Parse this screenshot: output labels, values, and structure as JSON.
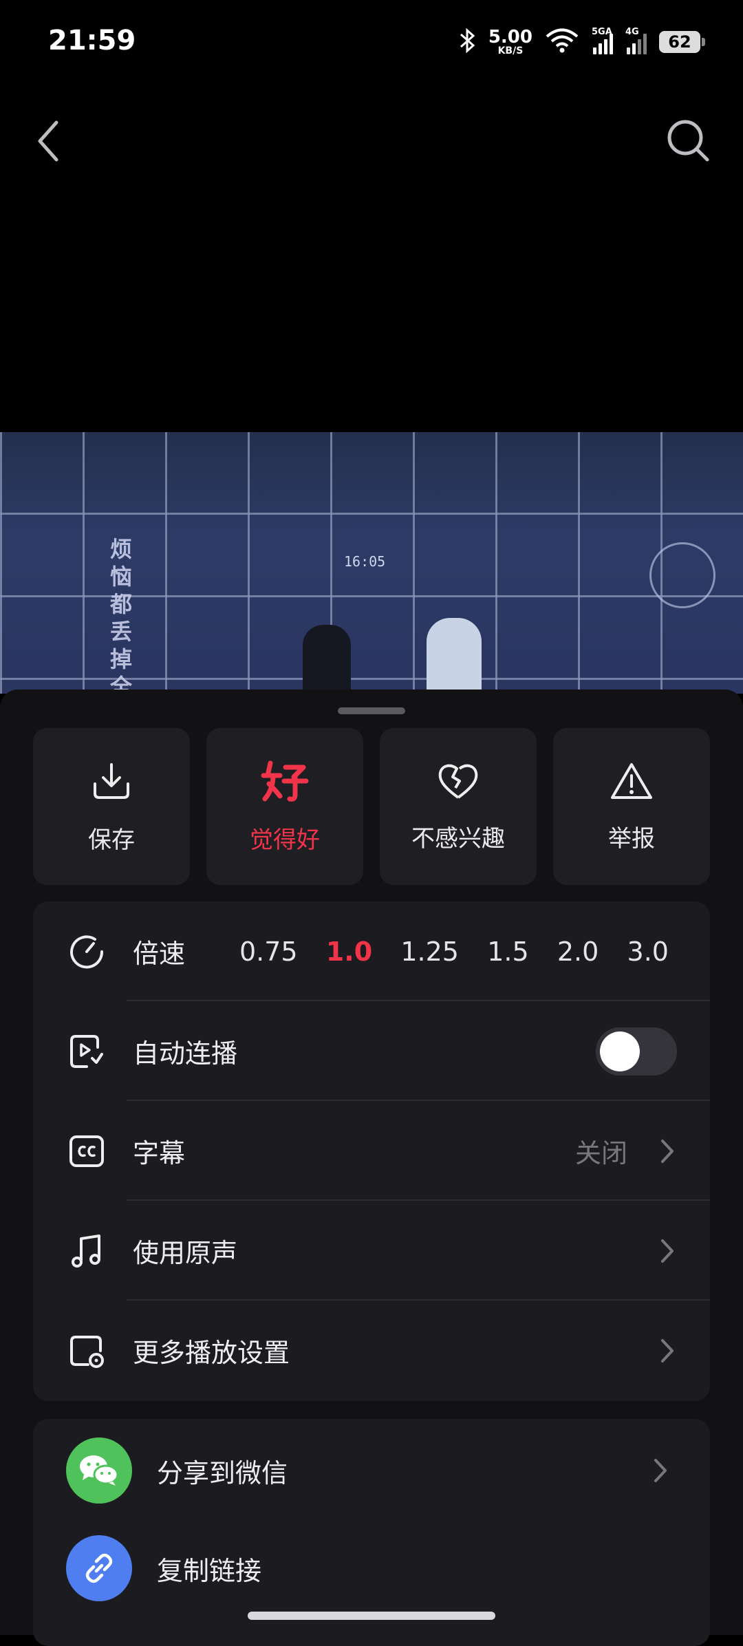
{
  "status_bar": {
    "time": "21:59",
    "net_speed_value": "5.00",
    "net_speed_unit": "KB/S",
    "signal1_tag": "5GA",
    "signal2_tag": "4G",
    "battery": "62"
  },
  "video": {
    "clock_text": "16:05",
    "wall_text": "烦恼都丢掉全部"
  },
  "actions": [
    {
      "label": "保存",
      "icon": "download-icon"
    },
    {
      "label": "觉得好",
      "icon": "good-icon",
      "active": true
    },
    {
      "label": "不感兴趣",
      "icon": "broken-heart-icon"
    },
    {
      "label": "举报",
      "icon": "warning-icon"
    }
  ],
  "settings": {
    "speed": {
      "title": "倍速",
      "options": [
        "0.75",
        "1.0",
        "1.25",
        "1.5",
        "2.0",
        "3.0"
      ],
      "selected": "1.0"
    },
    "autoplay": {
      "title": "自动连播",
      "enabled": false
    },
    "subtitles": {
      "title": "字幕",
      "value": "关闭"
    },
    "original_sound": {
      "title": "使用原声"
    },
    "more_settings": {
      "title": "更多播放设置"
    }
  },
  "share": {
    "wechat": {
      "title": "分享到微信"
    },
    "copy_link": {
      "title": "复制链接"
    }
  },
  "colors": {
    "accent": "#f2344a",
    "wechat": "#4fc25c",
    "link": "#4f7ef0"
  }
}
